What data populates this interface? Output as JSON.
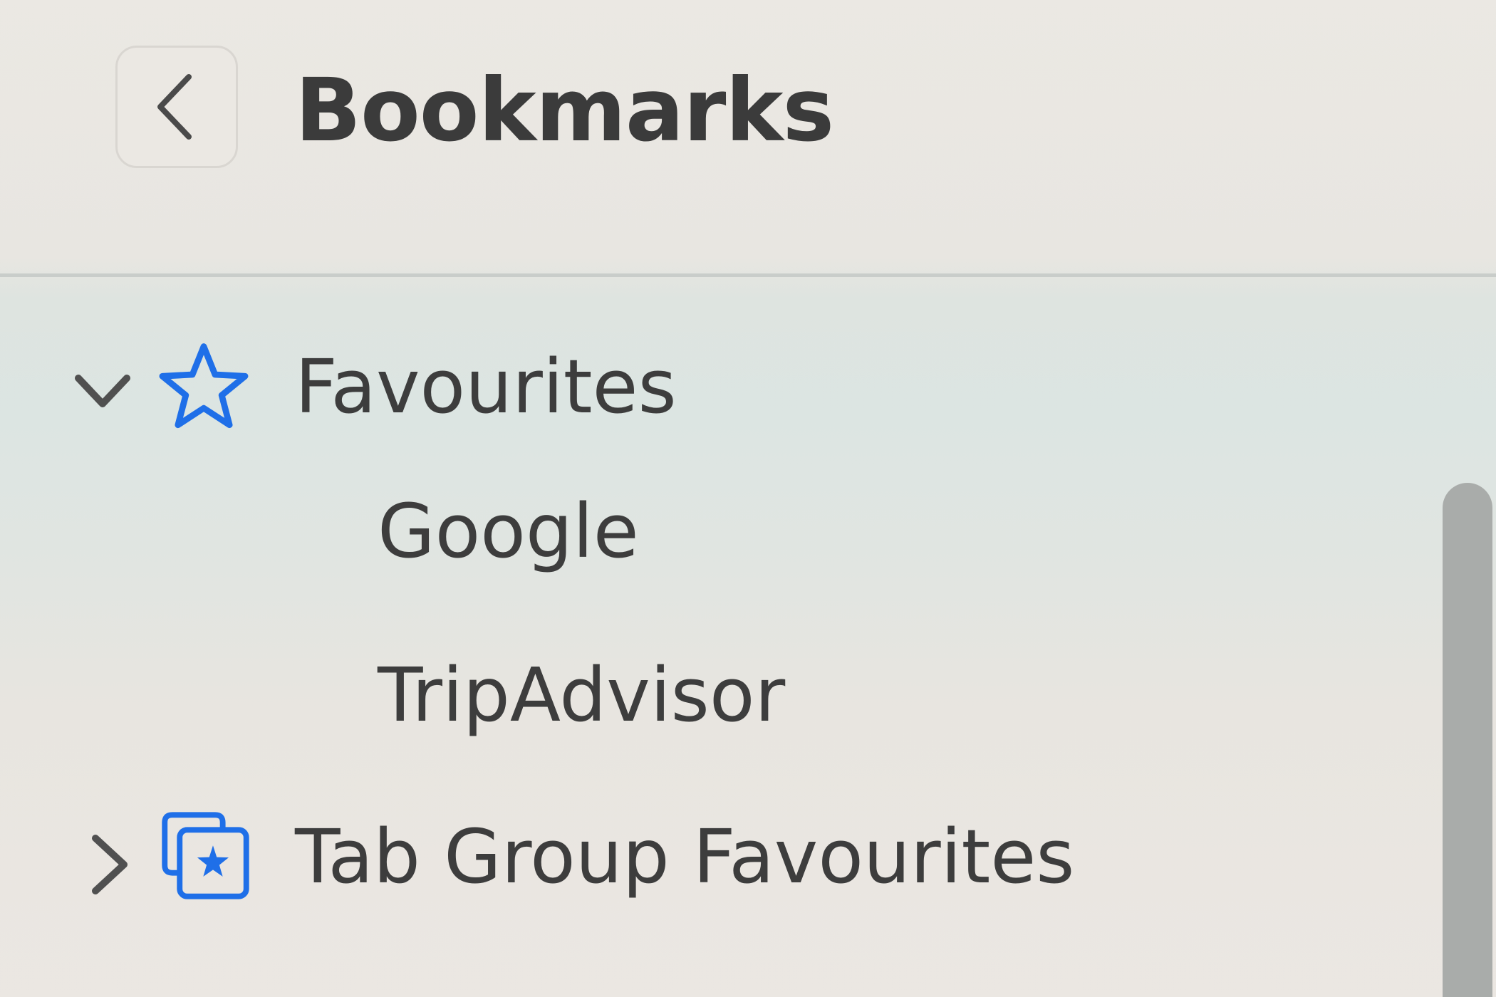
{
  "header": {
    "title": "Bookmarks",
    "back_icon": "chevron-left-icon"
  },
  "tree": {
    "items": [
      {
        "label": "Favourites",
        "icon": "star-icon",
        "expanded": true,
        "level": 0
      },
      {
        "label": "Google",
        "level": 1
      },
      {
        "label": "TripAdvisor",
        "level": 1
      },
      {
        "label": "Tab Group Favourites",
        "icon": "tab-group-star-icon",
        "expanded": false,
        "level": 0
      }
    ]
  },
  "colors": {
    "accent": "#1f6fe8",
    "text": "#3d3d3d",
    "chevron": "#505050",
    "scrollbar": "#a9acaa"
  }
}
